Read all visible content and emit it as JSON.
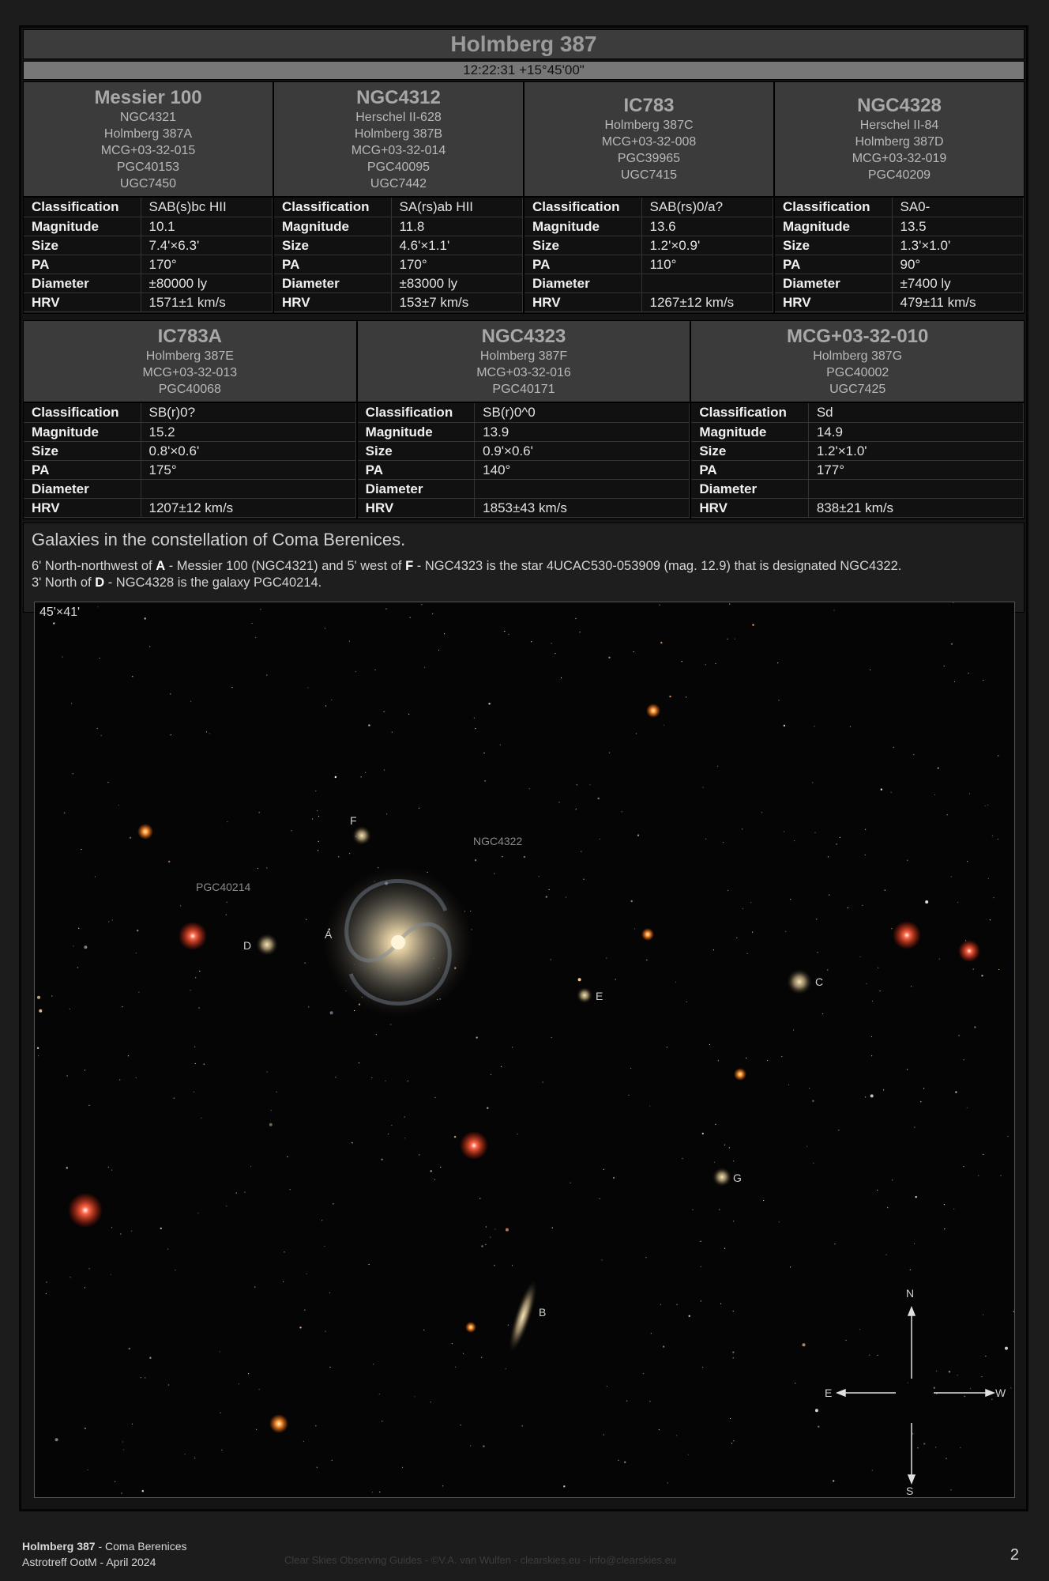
{
  "title": "Holmberg 387",
  "coordinates": "12:22:31 +15°45'00\"",
  "labels": {
    "classification": "Classification",
    "magnitude": "Magnitude",
    "size": "Size",
    "pa": "PA",
    "diameter": "Diameter",
    "hrv": "HRV"
  },
  "row1": [
    {
      "name": "Messier 100",
      "aliases": [
        "NGC4321",
        "Holmberg 387A",
        "MCG+03-32-015",
        "PGC40153",
        "UGC7450"
      ],
      "classification": "SAB(s)bc HII",
      "magnitude": "10.1",
      "size": "7.4'×6.3'",
      "pa": "170°",
      "diameter": "±80000 ly",
      "hrv": "1571±1 km/s"
    },
    {
      "name": "NGC4312",
      "aliases": [
        "Herschel II-628",
        "Holmberg 387B",
        "MCG+03-32-014",
        "PGC40095",
        "UGC7442"
      ],
      "classification": "SA(rs)ab HII",
      "magnitude": "11.8",
      "size": "4.6'×1.1'",
      "pa": "170°",
      "diameter": "±83000 ly",
      "hrv": "153±7 km/s"
    },
    {
      "name": "IC783",
      "aliases": [
        "Holmberg 387C",
        "MCG+03-32-008",
        "PGC39965",
        "UGC7415"
      ],
      "classification": "SAB(rs)0/a?",
      "magnitude": "13.6",
      "size": "1.2'×0.9'",
      "pa": "110°",
      "diameter": "",
      "hrv": "1267±12 km/s"
    },
    {
      "name": "NGC4328",
      "aliases": [
        "Herschel II-84",
        "Holmberg 387D",
        "MCG+03-32-019",
        "PGC40209"
      ],
      "classification": "SA0-",
      "magnitude": "13.5",
      "size": "1.3'×1.0'",
      "pa": "90°",
      "diameter": "±7400 ly",
      "hrv": "479±11 km/s"
    }
  ],
  "row2": [
    {
      "name": "IC783A",
      "aliases": [
        "Holmberg 387E",
        "MCG+03-32-013",
        "PGC40068"
      ],
      "classification": "SB(r)0?",
      "magnitude": "15.2",
      "size": "0.8'×0.6'",
      "pa": "175°",
      "diameter": "",
      "hrv": "1207±12 km/s"
    },
    {
      "name": "NGC4323",
      "aliases": [
        "Holmberg 387F",
        "MCG+03-32-016",
        "PGC40171"
      ],
      "classification": "SB(r)0^0",
      "magnitude": "13.9",
      "size": "0.9'×0.6'",
      "pa": "140°",
      "diameter": "",
      "hrv": "1853±43 km/s"
    },
    {
      "name": "MCG+03-32-010",
      "aliases": [
        "Holmberg 387G",
        "PGC40002",
        "UGC7425"
      ],
      "classification": "Sd",
      "magnitude": "14.9",
      "size": "1.2'×1.0'",
      "pa": "177°",
      "diameter": "",
      "hrv": "838±21 km/s"
    }
  ],
  "description": {
    "title": "Galaxies in the constellation of Coma Berenices.",
    "line1": {
      "t1": "6' North-northwest of ",
      "b1": "A",
      "t2": " - Messier 100 (NGC4321) and 5' west of ",
      "b2": "F",
      "t3": " - NGC4323 is the star 4UCAC530-053909 (mag. 12.9) that is designated NGC4322."
    },
    "line2": {
      "t1": "3' North of ",
      "b1": "D",
      "t2": " - NGC4328 is the galaxy PGC40214."
    }
  },
  "image": {
    "fov": "45'×41'",
    "labels": {
      "A": "A",
      "B": "B",
      "C": "C",
      "D": "D",
      "E": "E",
      "F": "F",
      "G": "G",
      "ngc4322": "NGC4322",
      "pgc40214": "PGC40214"
    },
    "compass": {
      "n": "N",
      "s": "S",
      "e": "E",
      "w": "W"
    }
  },
  "footer": {
    "object": "Holmberg 387",
    "constellation": " - Coma Berenices",
    "event": "Astrotreff OotM - April 2024",
    "credit": "Clear Skies Observing Guides - ©V.A. van Wulfen - clearskies.eu - info@clearskies.eu",
    "page": "2"
  }
}
